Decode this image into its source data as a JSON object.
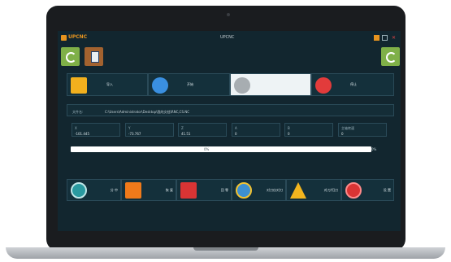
{
  "window": {
    "app_name": "UPCNC",
    "title": "UPCNC"
  },
  "actions": [
    {
      "label": "导入"
    },
    {
      "label": "开始"
    },
    {
      "label": ""
    },
    {
      "label": "停止"
    }
  ],
  "file": {
    "label": "文件名:",
    "path": "C:\\Users\\Administrator\\Desktop\\我的文档\\RNC,CS.NC"
  },
  "coords": [
    {
      "axis": "X",
      "value": "-101.445"
    },
    {
      "axis": "Y",
      "value": "-73.767"
    },
    {
      "axis": "Z",
      "value": "41.51"
    },
    {
      "axis": "A",
      "value": "0"
    },
    {
      "axis": "B",
      "value": "0"
    },
    {
      "axis": "主轴转速",
      "value": "0"
    }
  ],
  "progress": {
    "label": "0%",
    "percent_label": "0%",
    "value": 0
  },
  "functions": [
    {
      "label": "分 中"
    },
    {
      "label": "恢 复"
    },
    {
      "label": "回 零"
    },
    {
      "label": "对刀仪对刀"
    },
    {
      "label": "对刀/归刀"
    },
    {
      "label": "设 置"
    }
  ],
  "colors": {
    "screen_bg": "#12262f",
    "accent_orange": "#e7941f",
    "accent_green": "#7fb048",
    "stop_red": "#e23b3b"
  }
}
